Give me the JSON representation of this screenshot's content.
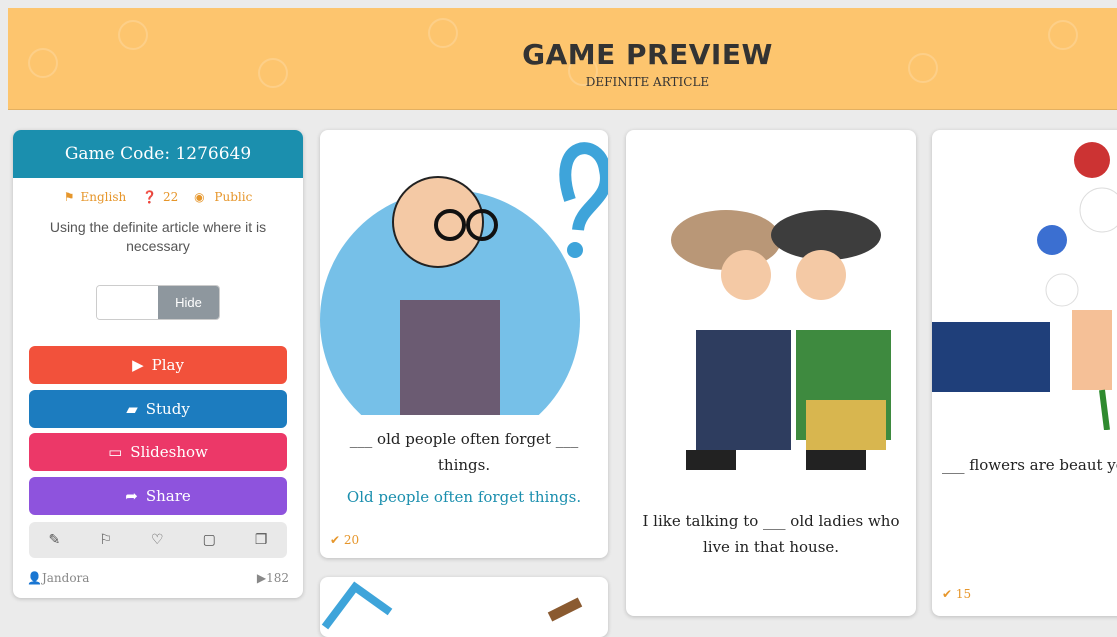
{
  "header": {
    "title": "GAME PREVIEW",
    "subtitle": "DEFINITE ARTICLE"
  },
  "panel": {
    "code_label": "Game Code: 1276649",
    "language": "English",
    "questions": "22",
    "visibility": "Public",
    "description": "Using the definite article where it is necessary",
    "toggle_label": "Hide",
    "buttons": {
      "play": "Play",
      "study": "Study",
      "slideshow": "Slideshow",
      "share": "Share"
    },
    "author": "Jandora",
    "plays": "182"
  },
  "cards": [
    {
      "question": "___ old people often forget ___ things.",
      "answer": "Old people often forget things.",
      "count": "20"
    },
    {
      "question": "I like talking to ___ old ladies who live in that house."
    },
    {
      "question": "___ flowers are beaut you very mu",
      "count": "15"
    }
  ],
  "colors": {
    "header": "#fdc56e",
    "code": "#1b8fae",
    "play": "#f2513b",
    "study": "#1c7cbf",
    "slideshow": "#ec3868",
    "share": "#8e53dd"
  }
}
